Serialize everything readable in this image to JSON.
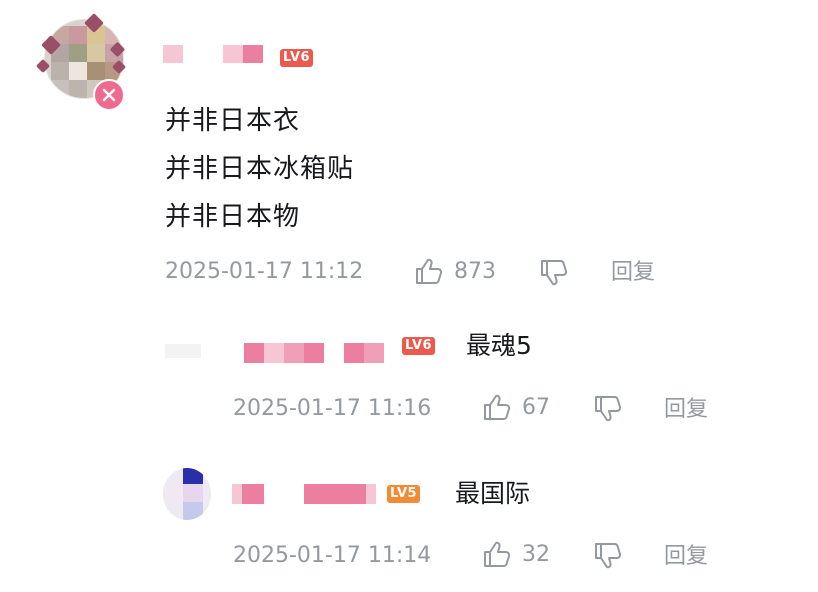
{
  "comments": [
    {
      "lines": [
        "并非日本衣",
        "并非日本冰箱贴",
        "并非日本物"
      ],
      "level": "LV6",
      "timestamp": "2025-01-17 11:12",
      "likes": "873",
      "reply_label": "回复"
    }
  ],
  "replies": [
    {
      "level": "LV6",
      "text": "最魂5",
      "timestamp": "2025-01-17 11:16",
      "likes": "67",
      "reply_label": "回复"
    },
    {
      "level": "LV5",
      "text": "最国际",
      "timestamp": "2025-01-17 11:14",
      "likes": "32",
      "reply_label": "回复"
    }
  ],
  "icons": {
    "like": "thumbs-up-icon",
    "dislike": "thumbs-down-icon"
  },
  "colors": {
    "level6": "#ec5a4e",
    "level5": "#f38a34",
    "meta_text": "#9499a0",
    "accent_pink": "#ec7fa0"
  }
}
